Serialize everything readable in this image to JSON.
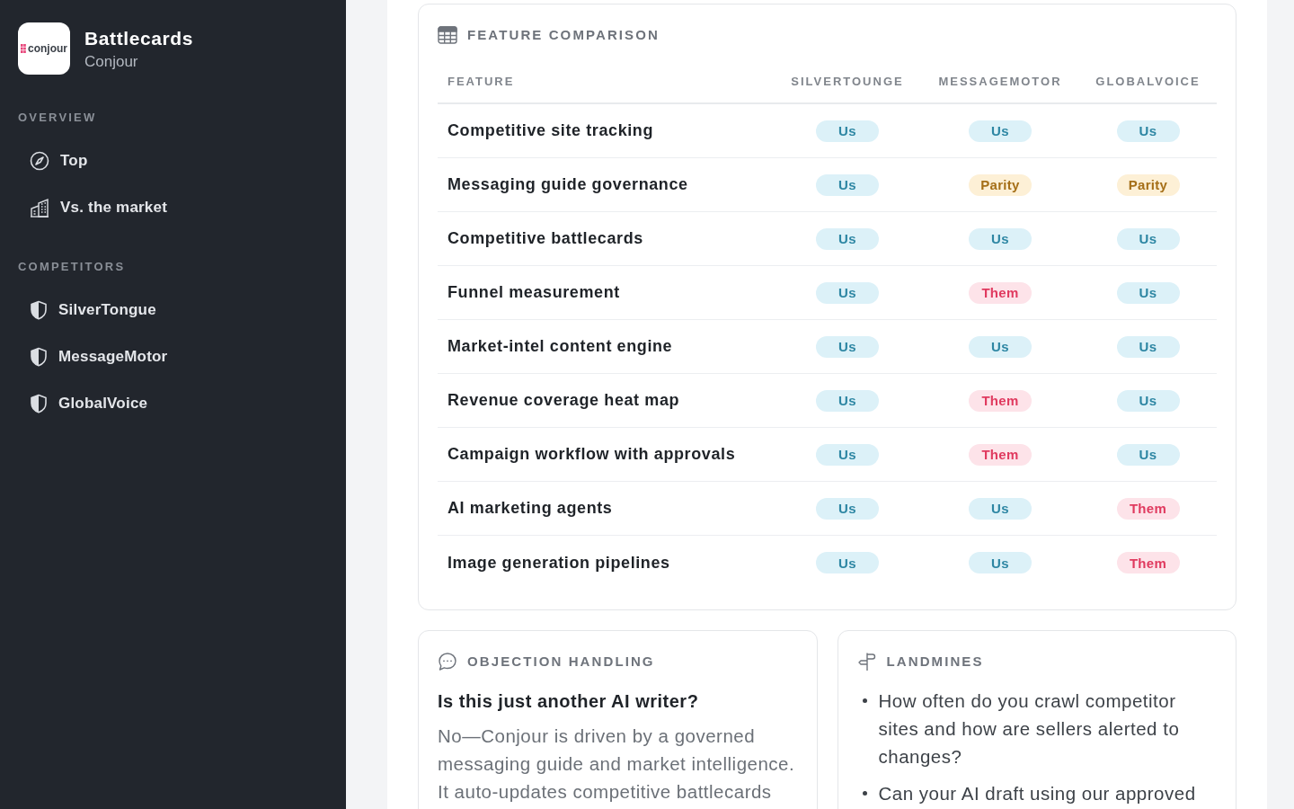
{
  "sidebar": {
    "logo_text": "conjour",
    "title": "Battlecards",
    "subtitle": "Conjour",
    "sections": [
      {
        "label": "OVERVIEW",
        "items": [
          {
            "label": "Top",
            "kind": "compass",
            "selected": false
          },
          {
            "label": "Vs. the market",
            "kind": "building",
            "selected": false
          }
        ]
      },
      {
        "label": "COMPETITORS",
        "items": [
          {
            "label": "SilverTongue",
            "kind": "shield",
            "selected": false
          },
          {
            "label": "MessageMotor",
            "kind": "shield",
            "selected": false
          },
          {
            "label": "GlobalVoice",
            "kind": "shield",
            "selected": false
          }
        ]
      }
    ]
  },
  "feature_comparison": {
    "title": "FEATURE COMPARISON",
    "columns": [
      "FEATURE",
      "SILVERTOUNGE",
      "MESSAGEMOTOR",
      "GLOBALVOICE"
    ],
    "rows": [
      {
        "feature": "Competitive site tracking",
        "verdicts": [
          {
            "label": "Us",
            "kind": "us"
          },
          {
            "label": "Us",
            "kind": "us"
          },
          {
            "label": "Us",
            "kind": "us"
          }
        ]
      },
      {
        "feature": "Messaging guide governance",
        "verdicts": [
          {
            "label": "Us",
            "kind": "us"
          },
          {
            "label": "Parity",
            "kind": "parity"
          },
          {
            "label": "Parity",
            "kind": "parity"
          }
        ]
      },
      {
        "feature": "Competitive battlecards",
        "verdicts": [
          {
            "label": "Us",
            "kind": "us"
          },
          {
            "label": "Us",
            "kind": "us"
          },
          {
            "label": "Us",
            "kind": "us"
          }
        ]
      },
      {
        "feature": "Funnel measurement",
        "verdicts": [
          {
            "label": "Us",
            "kind": "us"
          },
          {
            "label": "Them",
            "kind": "them"
          },
          {
            "label": "Us",
            "kind": "us"
          }
        ]
      },
      {
        "feature": "Market-intel content engine",
        "verdicts": [
          {
            "label": "Us",
            "kind": "us"
          },
          {
            "label": "Us",
            "kind": "us"
          },
          {
            "label": "Us",
            "kind": "us"
          }
        ]
      },
      {
        "feature": "Revenue coverage heat map",
        "verdicts": [
          {
            "label": "Us",
            "kind": "us"
          },
          {
            "label": "Them",
            "kind": "them"
          },
          {
            "label": "Us",
            "kind": "us"
          }
        ]
      },
      {
        "feature": "Campaign workflow with approvals",
        "verdicts": [
          {
            "label": "Us",
            "kind": "us"
          },
          {
            "label": "Them",
            "kind": "them"
          },
          {
            "label": "Us",
            "kind": "us"
          }
        ]
      },
      {
        "feature": "AI marketing agents",
        "verdicts": [
          {
            "label": "Us",
            "kind": "us"
          },
          {
            "label": "Us",
            "kind": "us"
          },
          {
            "label": "Them",
            "kind": "them"
          }
        ]
      },
      {
        "feature": "Image generation pipelines",
        "verdicts": [
          {
            "label": "Us",
            "kind": "us"
          },
          {
            "label": "Us",
            "kind": "us"
          },
          {
            "label": "Them",
            "kind": "them"
          }
        ]
      }
    ]
  },
  "objection_handling": {
    "title": "OBJECTION HANDLING",
    "question": "Is this just another AI writer?",
    "answer": "No—Conjour is driven by a governed messaging guide and market intelligence. It auto-updates competitive battlecards"
  },
  "landmines": {
    "title": "LANDMINES",
    "items": [
      "How often do you crawl competitor sites and how are sellers alerted to changes?",
      "Can your AI draft using our approved"
    ]
  }
}
